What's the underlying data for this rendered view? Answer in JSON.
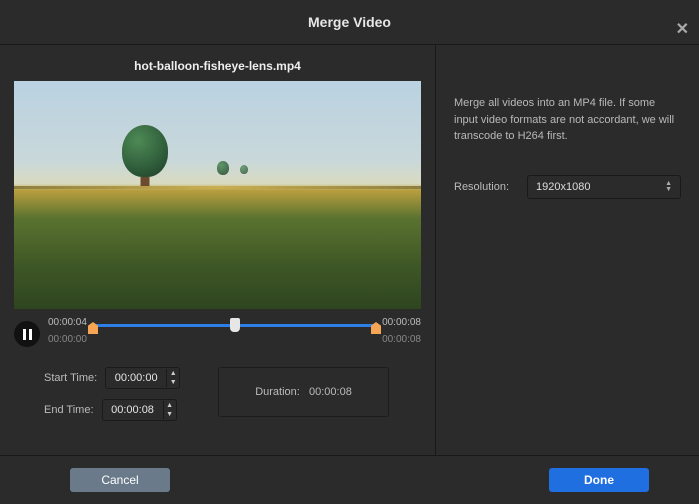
{
  "header": {
    "title": "Merge Video"
  },
  "file": {
    "name": "hot-balloon-fisheye-lens.mp4"
  },
  "player": {
    "trim_start_display": "00:00:04",
    "trim_end_display": "00:00:08",
    "full_start_display": "00:00:00",
    "full_end_display": "00:00:08"
  },
  "editors": {
    "start_label": "Start Time:",
    "end_label": "End Time:",
    "start_value": "00:00:00",
    "end_value": "00:00:08",
    "duration_label": "Duration:",
    "duration_value": "00:00:08"
  },
  "right": {
    "info": "Merge all videos into an MP4 file. If some input video formats are not accordant, we will transcode to H264 first.",
    "resolution_label": "Resolution:",
    "resolution_value": "1920x1080"
  },
  "footer": {
    "cancel": "Cancel",
    "done": "Done"
  }
}
